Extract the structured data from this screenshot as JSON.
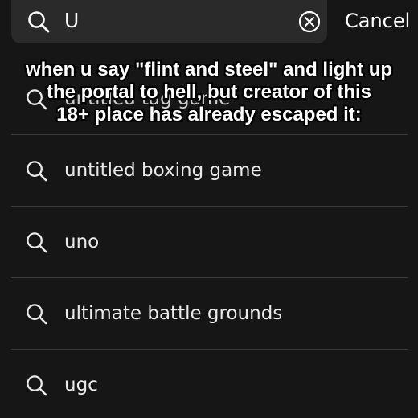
{
  "search": {
    "query": "U",
    "cancel_label": "Cancel",
    "icon": "search-icon",
    "clear_icon": "clear-circle-x-icon"
  },
  "suggestions": [
    {
      "text": "untitled tag game"
    },
    {
      "text": "untitled boxing game"
    },
    {
      "text": "uno"
    },
    {
      "text": "ultimate battle grounds"
    },
    {
      "text": "ugc"
    }
  ],
  "caption": {
    "lines": [
      "when u say \"flint and steel\" and light up",
      "the portal to hell, but creator of this",
      "18+ place has already escaped it:"
    ],
    "color": "#ffffff",
    "outline_color": "#000000"
  },
  "colors": {
    "background": "#161616",
    "search_field": "#2a2a2a",
    "divider": "#3a3a3a",
    "text": "#ffffff"
  }
}
